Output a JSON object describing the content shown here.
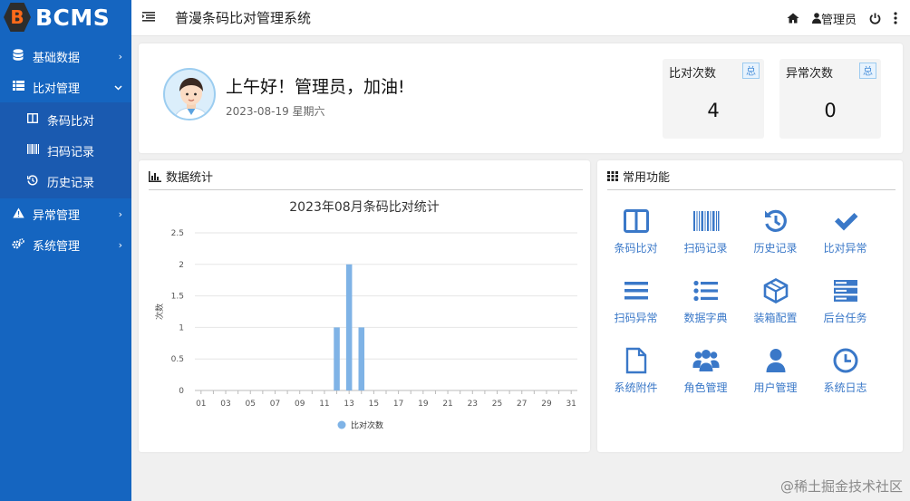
{
  "logo": {
    "badge": "B",
    "text": "BCMS"
  },
  "topbar": {
    "title": "普漫条码比对管理系统",
    "user": "管理员"
  },
  "sidebar": {
    "items": [
      {
        "label": "基础数据",
        "icon": "database-icon",
        "chevron": "›"
      },
      {
        "label": "比对管理",
        "icon": "list-icon",
        "chevron": "⌄"
      },
      {
        "label": "异常管理",
        "icon": "warning-icon",
        "chevron": "›"
      },
      {
        "label": "系统管理",
        "icon": "cogs-icon",
        "chevron": "›"
      }
    ],
    "sub_items": [
      {
        "label": "条码比对",
        "icon": "columns-icon"
      },
      {
        "label": "扫码记录",
        "icon": "barcode-icon"
      },
      {
        "label": "历史记录",
        "icon": "history-icon"
      }
    ]
  },
  "welcome": {
    "greeting": "上午好！管理员，加油!",
    "date": "2023-08-19 星期六"
  },
  "stats": [
    {
      "label": "比对次数",
      "tag": "总",
      "value": "4"
    },
    {
      "label": "异常次数",
      "tag": "总",
      "value": "0"
    }
  ],
  "panels": {
    "stats_title": "数据统计",
    "func_title": "常用功能"
  },
  "functions": [
    {
      "label": "条码比对",
      "icon": "columns-icon"
    },
    {
      "label": "扫码记录",
      "icon": "barcode-icon"
    },
    {
      "label": "历史记录",
      "icon": "history-icon"
    },
    {
      "label": "比对异常",
      "icon": "check-icon"
    },
    {
      "label": "扫码异常",
      "icon": "bars-icon"
    },
    {
      "label": "数据字典",
      "icon": "list-ul-icon"
    },
    {
      "label": "装箱配置",
      "icon": "cube-icon"
    },
    {
      "label": "后台任务",
      "icon": "server-icon"
    },
    {
      "label": "系统附件",
      "icon": "file-icon"
    },
    {
      "label": "角色管理",
      "icon": "users-icon"
    },
    {
      "label": "用户管理",
      "icon": "user-icon"
    },
    {
      "label": "系统日志",
      "icon": "clock-icon"
    }
  ],
  "colors": {
    "sidebar": "#1565c0",
    "accent": "#3a78c8",
    "bar": "#7fb3e6"
  },
  "watermark": "@稀土掘金技术社区",
  "chart_data": {
    "type": "bar",
    "title": "2023年08月条码比对统计",
    "ylabel": "次数",
    "xlabel": "",
    "ylim": [
      0,
      2.5
    ],
    "y_ticks": [
      "0",
      "0.5",
      "1",
      "1.5",
      "2",
      "2.5"
    ],
    "categories": [
      "01",
      "02",
      "03",
      "04",
      "05",
      "06",
      "07",
      "08",
      "09",
      "10",
      "11",
      "12",
      "13",
      "14",
      "15",
      "16",
      "17",
      "18",
      "19",
      "20",
      "21",
      "22",
      "23",
      "24",
      "25",
      "26",
      "27",
      "28",
      "29",
      "30",
      "31"
    ],
    "x_tick_labels": [
      "01",
      "03",
      "05",
      "07",
      "09",
      "11",
      "13",
      "15",
      "17",
      "19",
      "21",
      "23",
      "25",
      "27",
      "29",
      "31"
    ],
    "series": [
      {
        "name": "比对次数",
        "values": [
          0,
          0,
          0,
          0,
          0,
          0,
          0,
          0,
          0,
          0,
          0,
          1,
          2,
          1,
          0,
          0,
          0,
          0,
          0,
          0,
          0,
          0,
          0,
          0,
          0,
          0,
          0,
          0,
          0,
          0,
          0
        ]
      }
    ],
    "legend": "bottom",
    "grid": true
  }
}
